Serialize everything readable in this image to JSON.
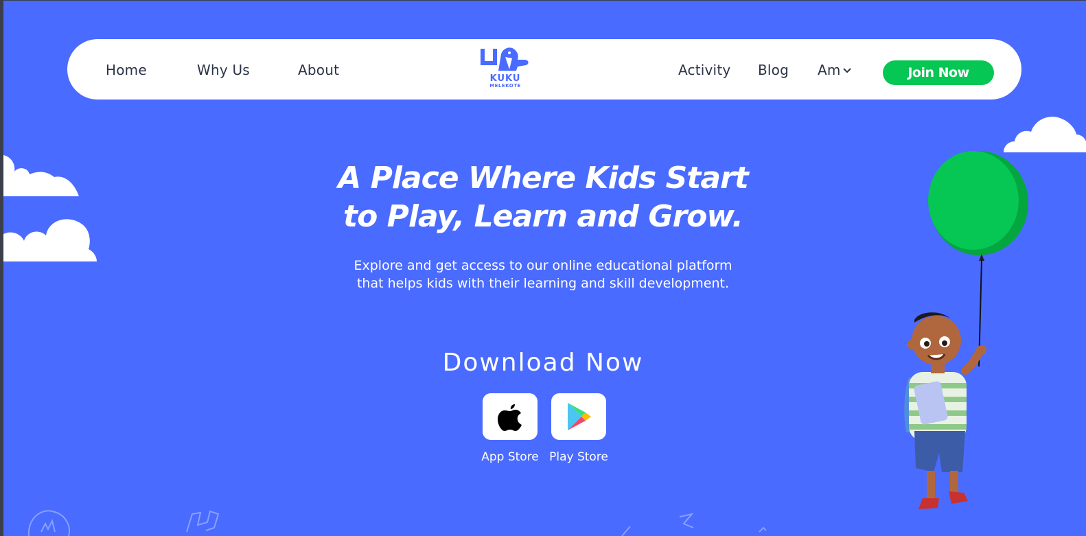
{
  "nav": {
    "home": "Home",
    "why_us": "Why Us",
    "about": "About",
    "activity": "Activity",
    "blog": "Blog",
    "language": "Am",
    "join": "Join Now"
  },
  "logo": {
    "line1": "KUKU",
    "line2": "MELEKOTE"
  },
  "hero": {
    "title_line1": "A Place Where Kids Start",
    "title_line2": "to Play, Learn and Grow.",
    "subtitle_line1": "Explore and get access to our online educational platform",
    "subtitle_line2": "that helps kids with their learning and skill development."
  },
  "download": {
    "title": "Download Now",
    "app_store": "App Store",
    "play_store": "Play Store"
  },
  "colors": {
    "background": "#4a6bff",
    "accent_green": "#06c654",
    "nav_text": "#2b3346"
  }
}
